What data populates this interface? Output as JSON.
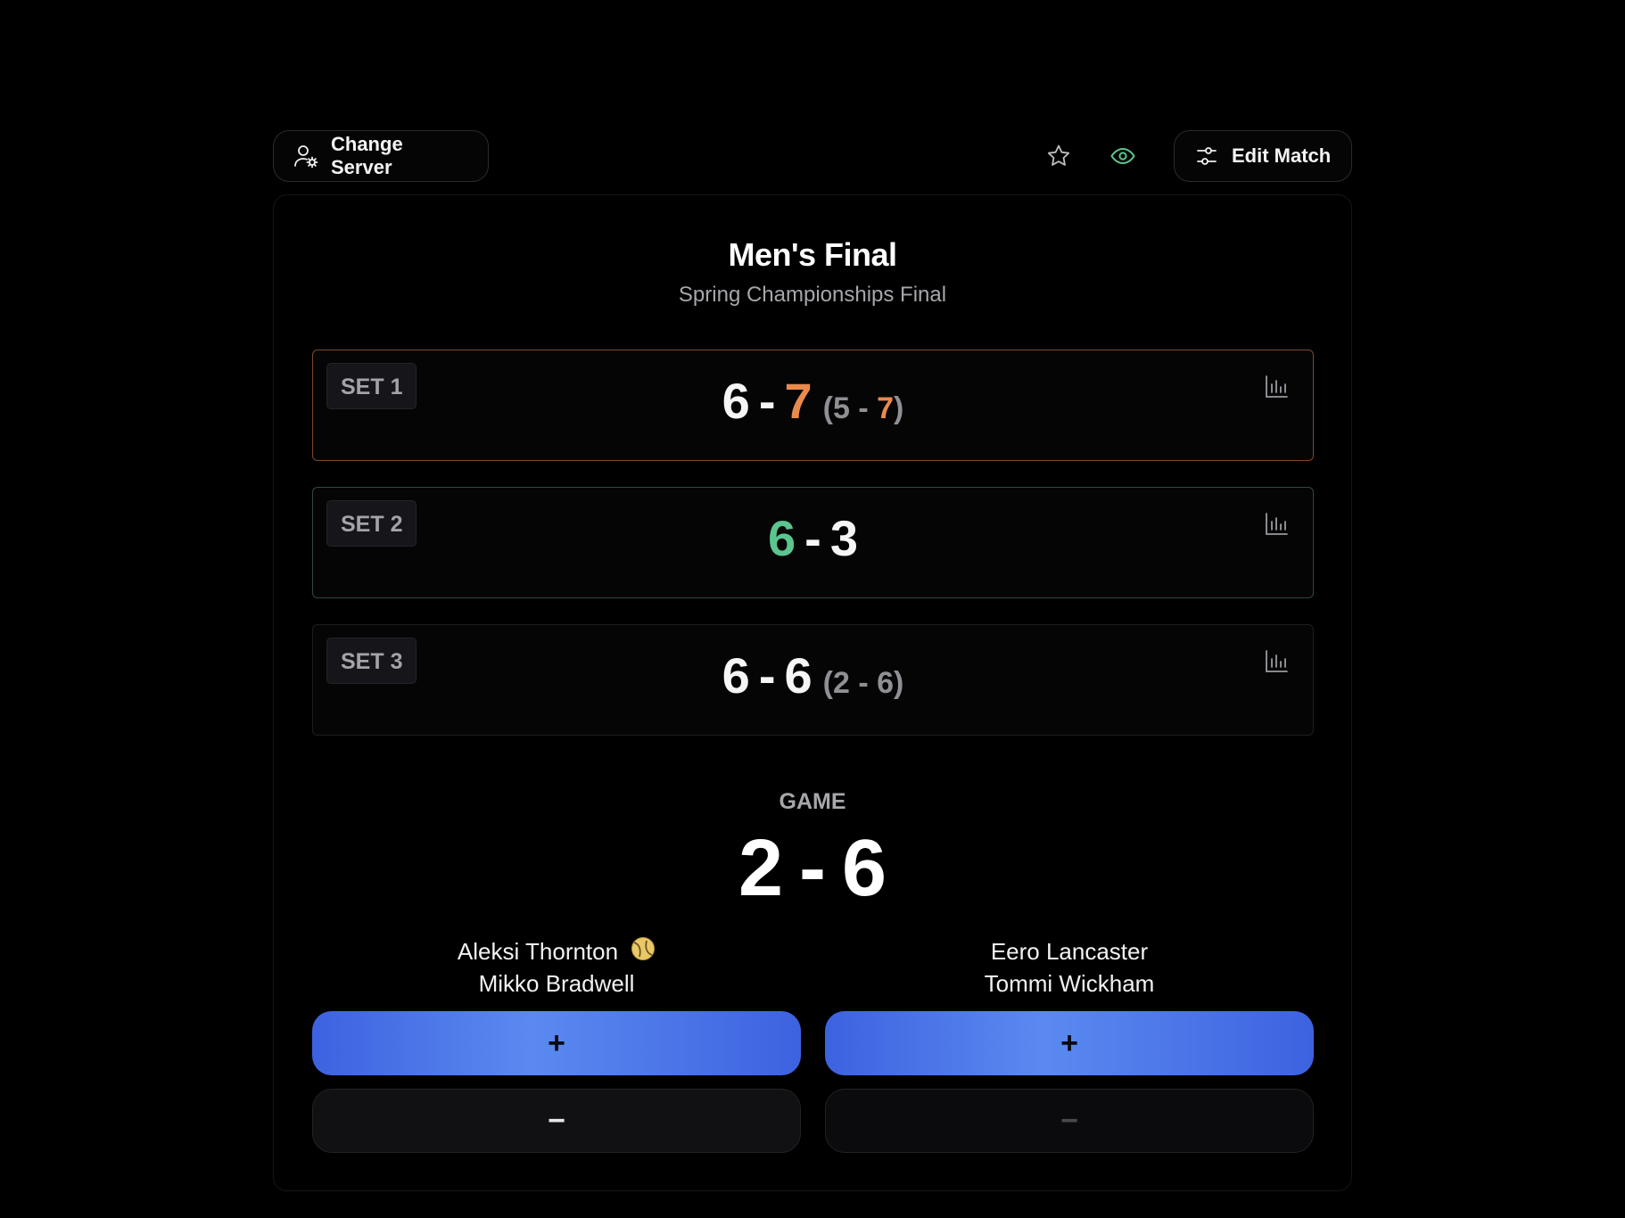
{
  "toolbar": {
    "change_server_label": "Change Server",
    "edit_match_label": "Edit Match",
    "favorite_icon": "star-icon",
    "watch_icon": "eye-icon",
    "watch_icon_color": "#5bc48f"
  },
  "match": {
    "title": "Men's Final",
    "subtitle": "Spring Championships Final"
  },
  "sets": [
    {
      "label": "SET 1",
      "score_a": "6",
      "score_b": "7",
      "tiebreak_a": "5",
      "tiebreak_b": "7",
      "winner": "b",
      "accent": "#e98a4c"
    },
    {
      "label": "SET 2",
      "score_a": "6",
      "score_b": "3",
      "winner": "a",
      "accent": "#5bc48f"
    },
    {
      "label": "SET 3",
      "score_a": "6",
      "score_b": "6",
      "tiebreak_a": "2",
      "tiebreak_b": "6"
    }
  ],
  "game": {
    "label": "GAME",
    "score_a": "2",
    "score_b": "6"
  },
  "teams": {
    "a": {
      "player1": "Aleksi Thornton",
      "player2": "Mikko Bradwell",
      "serving": true
    },
    "b": {
      "player1": "Eero Lancaster",
      "player2": "Tommi Wickham",
      "serving": false
    }
  },
  "controls": {
    "plus_label": "+",
    "minus_label": "−"
  }
}
